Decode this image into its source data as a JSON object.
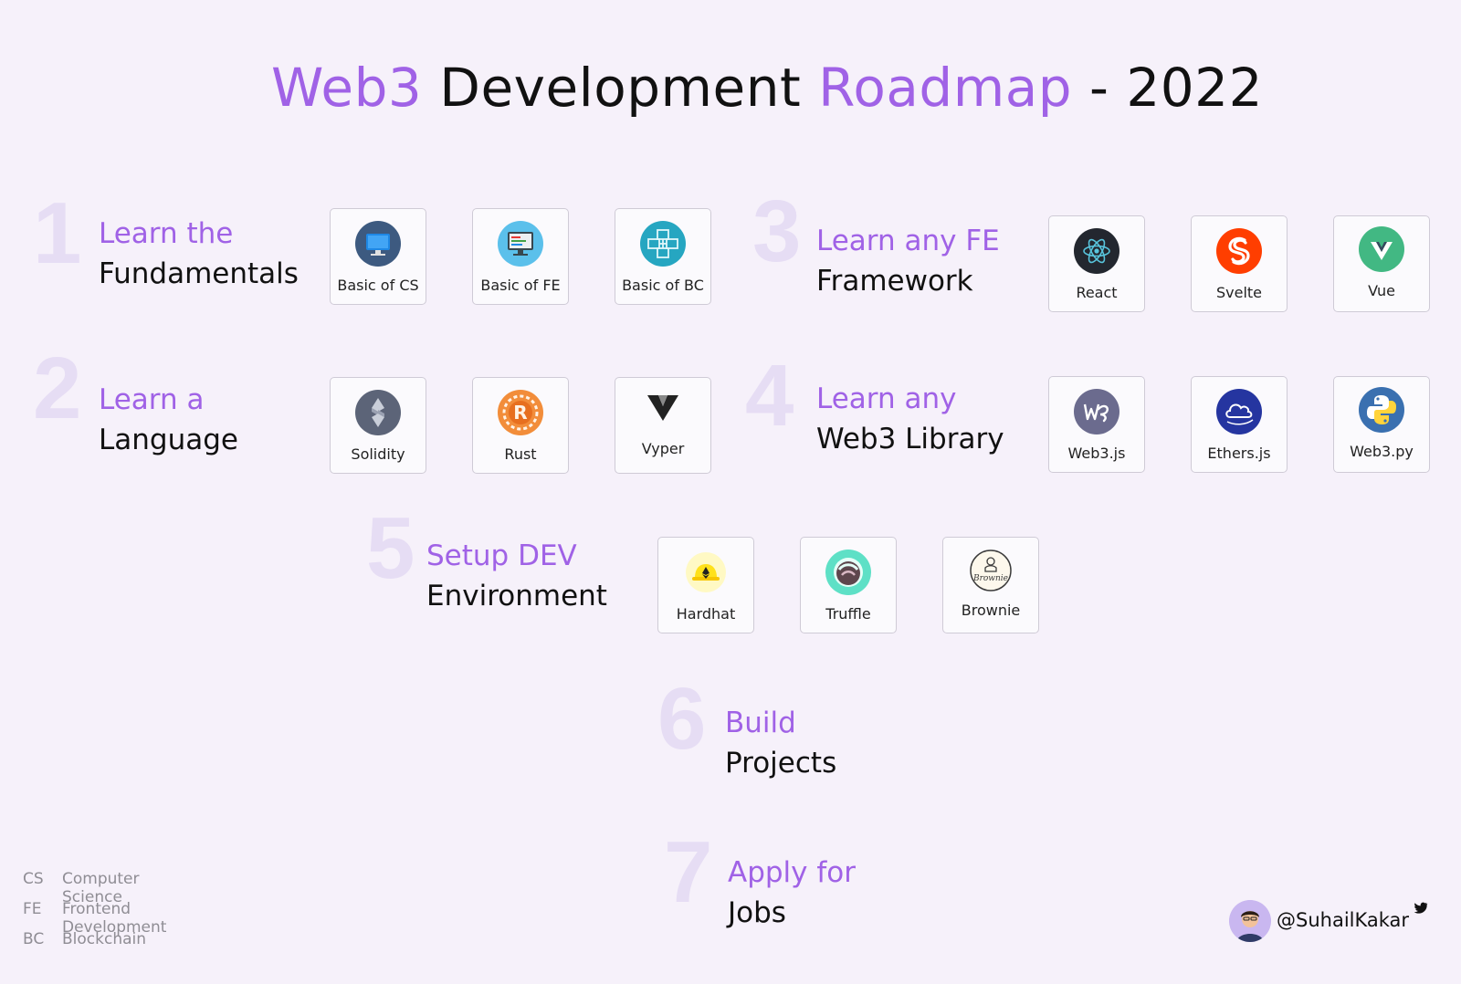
{
  "title": {
    "part1": "Web3",
    "part2": "Development",
    "part3": "Roadmap",
    "part4": "- 2022"
  },
  "steps": [
    {
      "number": "1",
      "line1": "Learn the",
      "line2": "Fundamentals",
      "items": [
        {
          "label": "Basic of CS",
          "icon": "monitor-icon"
        },
        {
          "label": "Basic of FE",
          "icon": "code-screen-icon"
        },
        {
          "label": "Basic of BC",
          "icon": "blockchain-cubes-icon"
        }
      ]
    },
    {
      "number": "2",
      "line1": "Learn a",
      "line2": "Language",
      "items": [
        {
          "label": "Solidity",
          "icon": "solidity-icon"
        },
        {
          "label": "Rust",
          "icon": "rust-icon"
        },
        {
          "label": "Vyper",
          "icon": "vyper-icon"
        }
      ]
    },
    {
      "number": "3",
      "line1": "Learn any FE",
      "line2": "Framework",
      "items": [
        {
          "label": "React",
          "icon": "react-icon"
        },
        {
          "label": "Svelte",
          "icon": "svelte-icon"
        },
        {
          "label": "Vue",
          "icon": "vue-icon"
        }
      ]
    },
    {
      "number": "4",
      "line1": "Learn any",
      "line2": "Web3 Library",
      "items": [
        {
          "label": "Web3.js",
          "icon": "web3js-icon"
        },
        {
          "label": "Ethers.js",
          "icon": "ethersjs-icon"
        },
        {
          "label": "Web3.py",
          "icon": "python-icon"
        }
      ]
    },
    {
      "number": "5",
      "line1": "Setup DEV",
      "line2": "Environment",
      "items": [
        {
          "label": "Hardhat",
          "icon": "hardhat-icon"
        },
        {
          "label": "Truffle",
          "icon": "truffle-icon"
        },
        {
          "label": "Brownie",
          "icon": "brownie-icon"
        }
      ]
    },
    {
      "number": "6",
      "line1": "Build",
      "line2": "Projects",
      "items": []
    },
    {
      "number": "7",
      "line1": "Apply for",
      "line2": "Jobs",
      "items": []
    }
  ],
  "legend": [
    {
      "abbr": "CS",
      "full": "Computer Science"
    },
    {
      "abbr": "FE",
      "full": "Frontend Development"
    },
    {
      "abbr": "BC",
      "full": "Blockchain"
    }
  ],
  "author": {
    "handle": "@SuhailKakar",
    "icon": "twitter-icon"
  },
  "colors": {
    "accent": "#a062e6",
    "number": "#e6ddf4",
    "background": "#f6f1fa",
    "text": "#111111"
  }
}
